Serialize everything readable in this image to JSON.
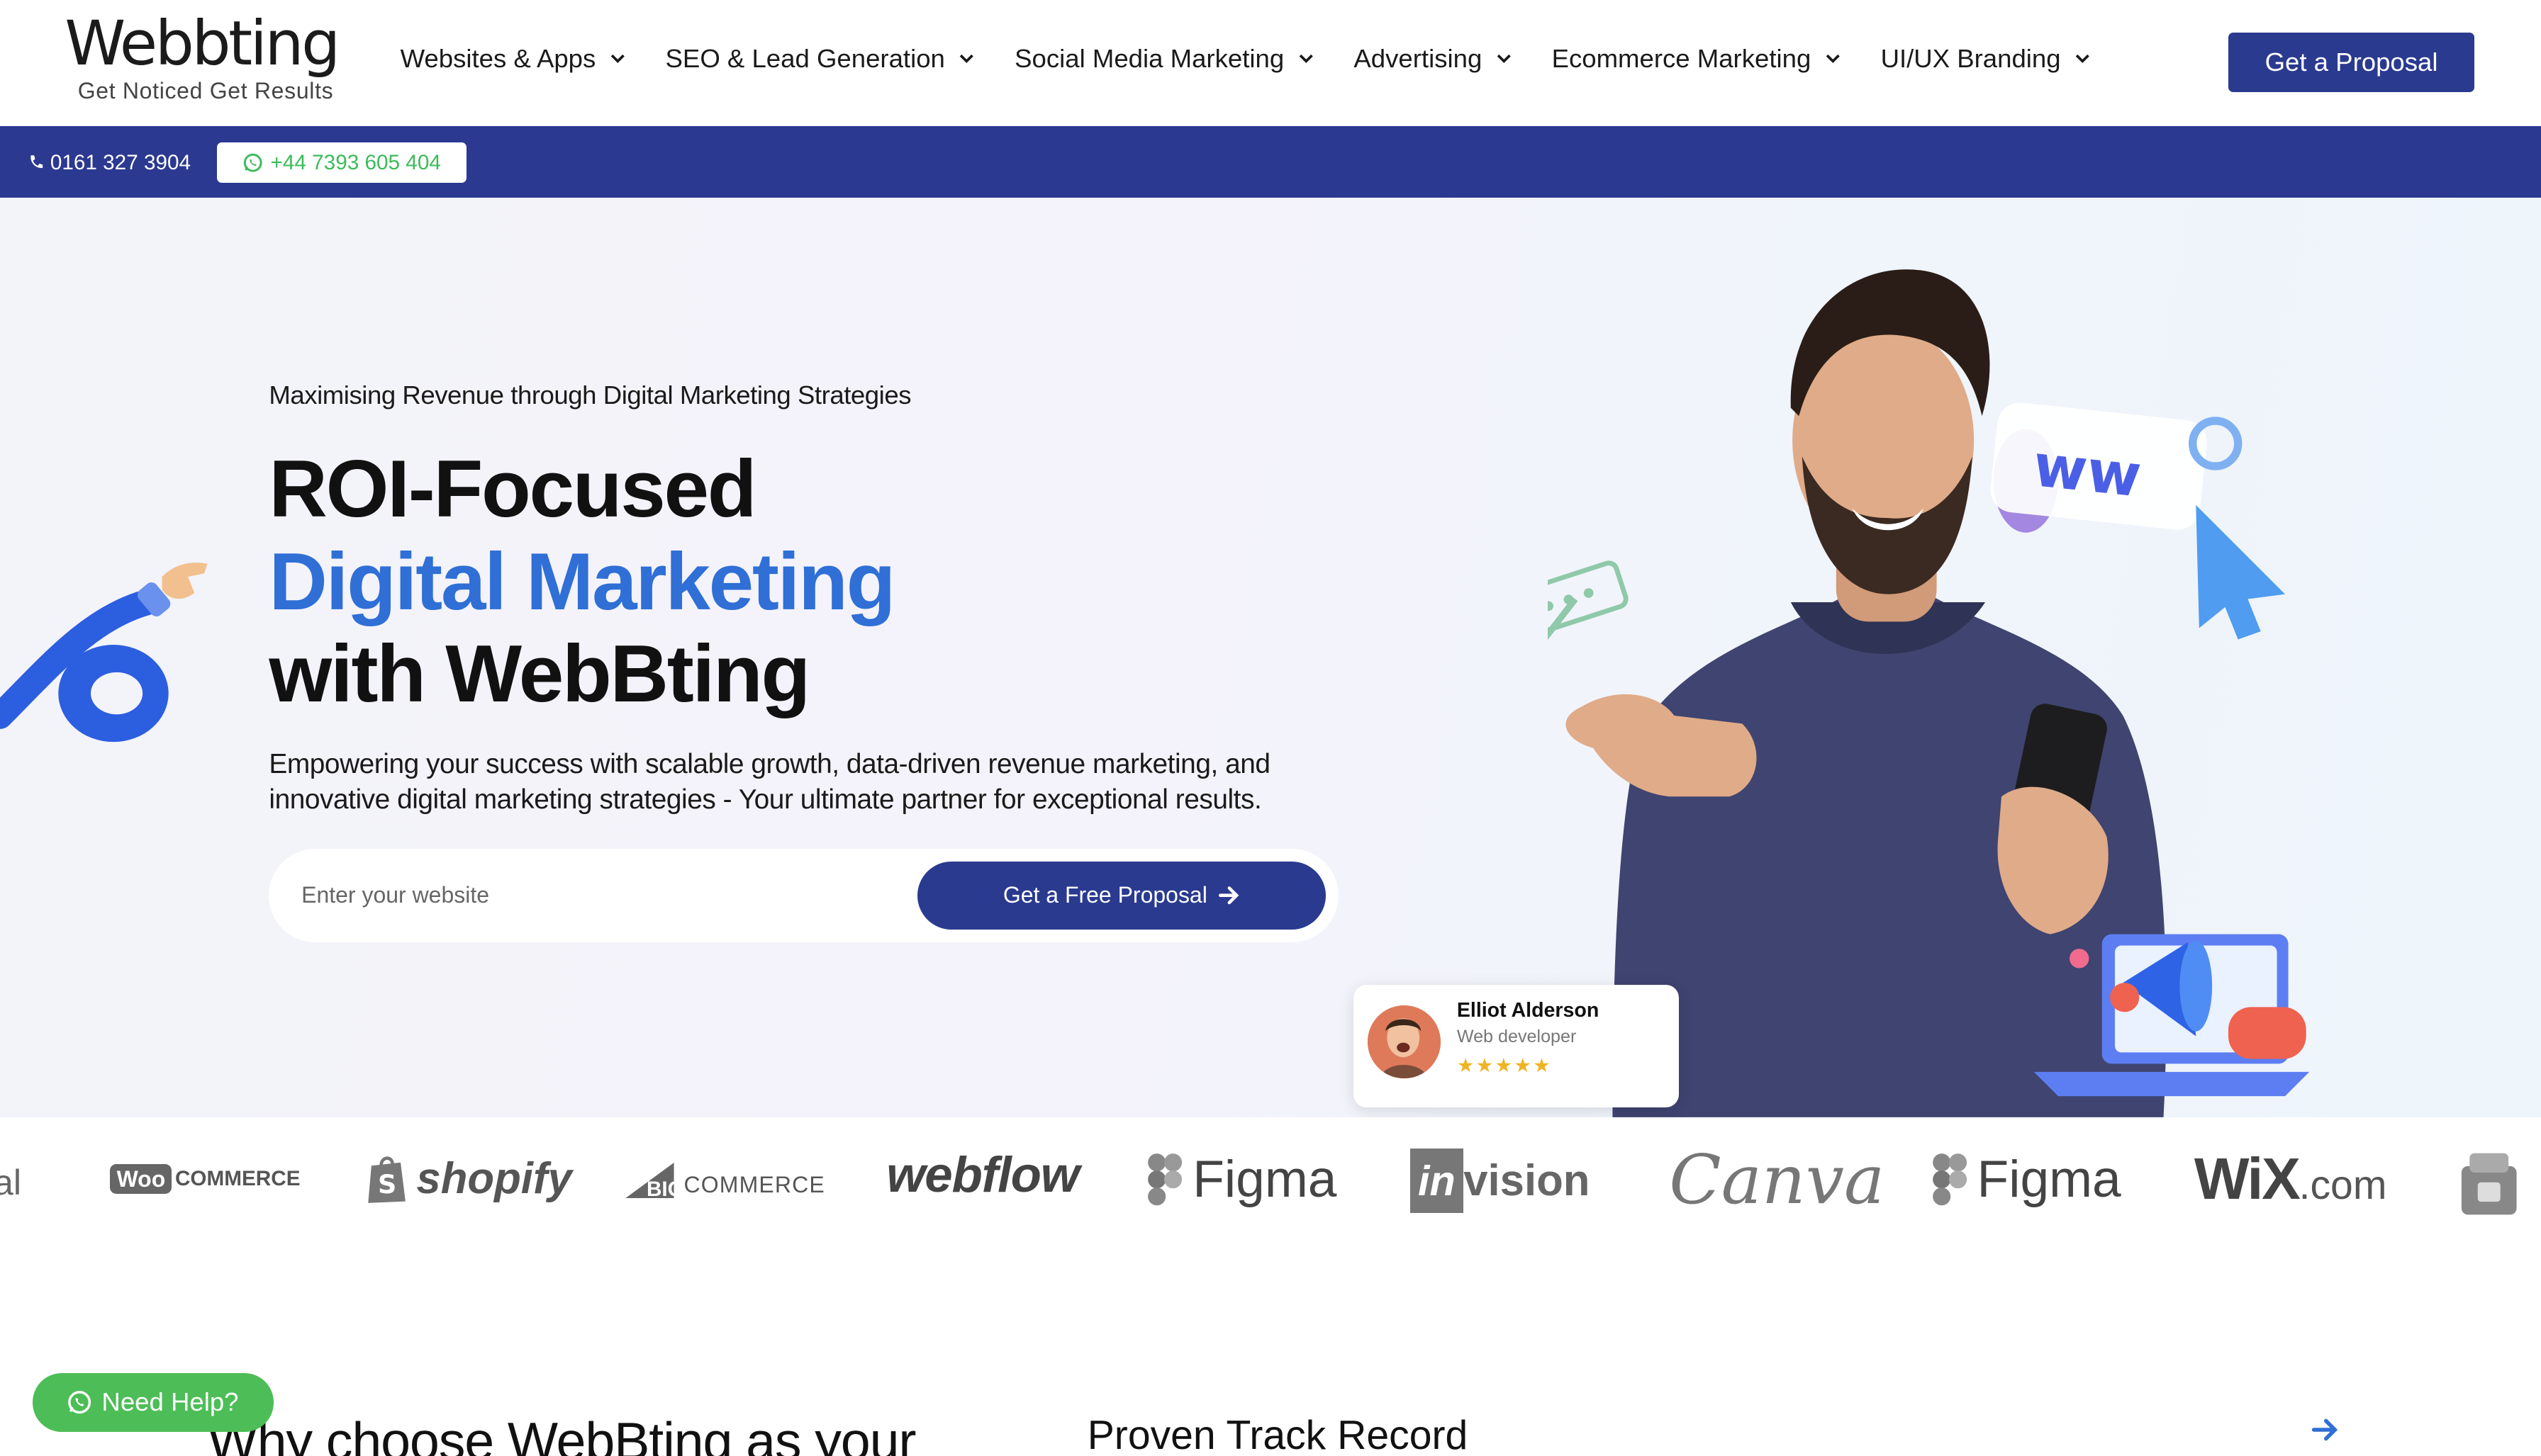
{
  "brand": {
    "name": "Webbting",
    "tagline": "Get Noticed  Get Results"
  },
  "nav": {
    "items": [
      {
        "label": "Websites & Apps"
      },
      {
        "label": "SEO & Lead Generation"
      },
      {
        "label": "Social Media Marketing"
      },
      {
        "label": "Advertising"
      },
      {
        "label": "Ecommerce Marketing"
      },
      {
        "label": "UI/UX Branding"
      }
    ],
    "cta": "Get a Proposal"
  },
  "contact": {
    "phone": "0161 327 3904",
    "whatsapp": "+44 7393 605 404"
  },
  "hero": {
    "eyebrow": "Maximising Revenue through Digital Marketing Strategies",
    "headline_1": "ROI-Focused",
    "headline_2": "Digital Marketing",
    "headline_3": "with WebBting",
    "description": "Empowering your success with scalable growth, data-driven revenue marketing, and innovative digital marketing strategies - Your ultimate partner for exceptional results.",
    "input_placeholder": "Enter your website",
    "button": "Get a Free Proposal"
  },
  "review": {
    "name": "Elliot Alderson",
    "role": "Web developer",
    "stars": "★★★★★"
  },
  "logos": {
    "partial_left": "al",
    "woo_badge": "Woo",
    "woo_text": "COMMERCE",
    "shopify": "shopify",
    "bigcommerce_prefix": "BIG",
    "bigcommerce_suffix": "COMMERCE",
    "webflow": "webflow",
    "figma_1": "Figma",
    "invision_prefix": "in",
    "invision_suffix": "vision",
    "canva": "Canva",
    "figma_2": "Figma",
    "wix_main": "WiX",
    "wix_suffix": ".com"
  },
  "lower": {
    "why_title": "Why choose WebBting as your",
    "track_title": "Proven Track Record"
  },
  "help": {
    "label": "Need Help?"
  },
  "colors": {
    "primary": "#2a3a8f",
    "accent_blue": "#2f6fd6",
    "whatsapp_green": "#4dbd57",
    "star": "#f0b324"
  }
}
